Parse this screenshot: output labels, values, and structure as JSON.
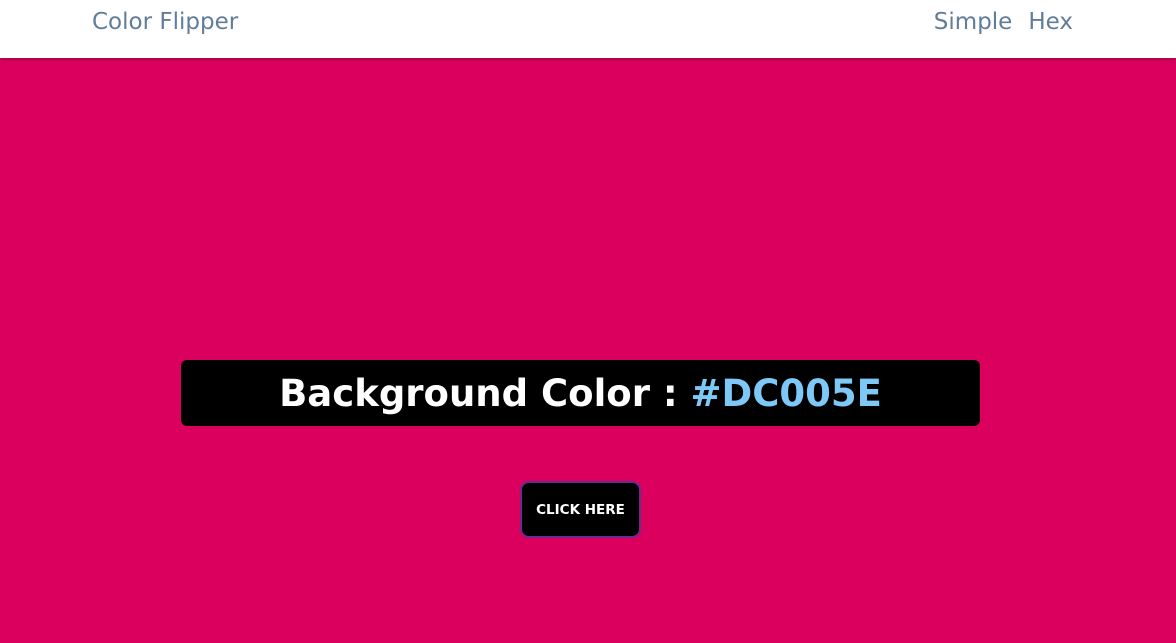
{
  "navbar": {
    "brand": "Color Flipper",
    "links": [
      {
        "label": "Simple"
      },
      {
        "label": "Hex"
      }
    ]
  },
  "main": {
    "label": "Background Color : ",
    "color_value": "#DC005E",
    "button_label": "CLICK HERE"
  },
  "colors": {
    "background": "#DC005E",
    "nav_text": "#617d98",
    "value_text": "#7ec8f7"
  }
}
